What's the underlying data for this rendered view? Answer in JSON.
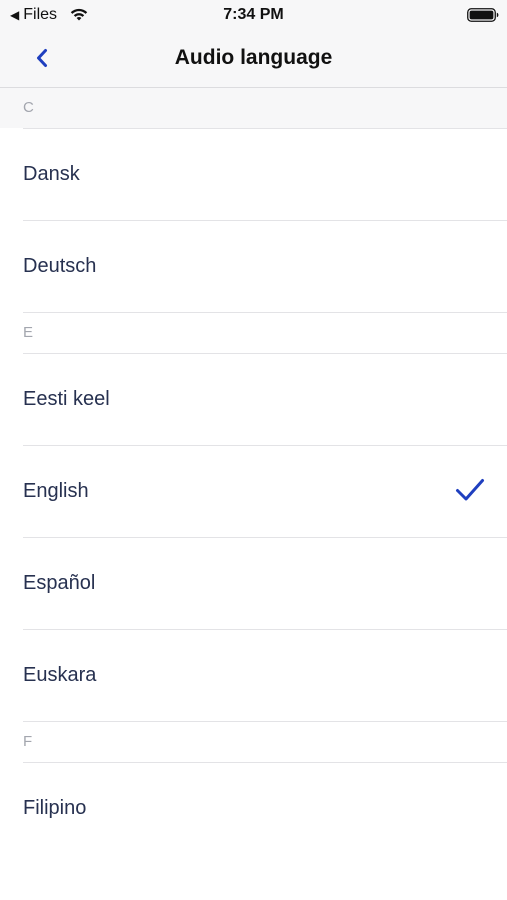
{
  "status_bar": {
    "back_label": "Files",
    "back_arrow": "◀",
    "time": "7:34 PM",
    "icons": [
      "wifi-icon",
      "battery-icon"
    ]
  },
  "nav": {
    "title": "Audio language",
    "back_icon": "chevron-left-icon"
  },
  "accent_color": "#1f3fbf",
  "sections": [
    {
      "header": "C",
      "items": [
        {
          "label": "Dansk",
          "selected": false
        },
        {
          "label": "Deutsch",
          "selected": false
        }
      ]
    },
    {
      "header": "E",
      "items": [
        {
          "label": "Eesti keel",
          "selected": false
        },
        {
          "label": "English",
          "selected": true
        },
        {
          "label": "Español",
          "selected": false
        },
        {
          "label": "Euskara",
          "selected": false
        }
      ]
    },
    {
      "header": "F",
      "items": [
        {
          "label": "Filipino",
          "selected": false
        }
      ]
    }
  ]
}
